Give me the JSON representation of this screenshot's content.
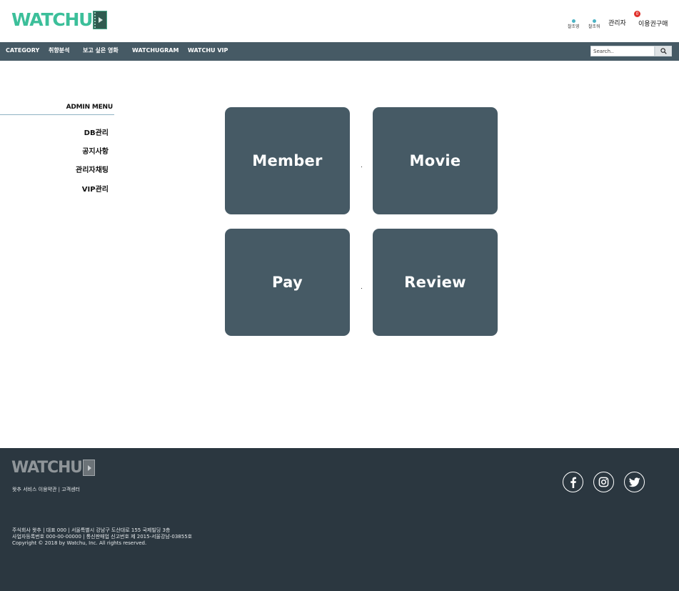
{
  "header": {
    "logo_text": "WATCHU",
    "util_1_label": "찰조영",
    "util_2_label": "찰조워",
    "admin_label": "관리자",
    "cart_count": "0",
    "buy_label": "이용권구매"
  },
  "nav": {
    "items": [
      {
        "label": "CATEGORY"
      },
      {
        "label": "취향분석"
      },
      {
        "label": "보고 싶은 영화"
      },
      {
        "label": "WATCHUGRAM"
      },
      {
        "label": "WATCHU VIP"
      }
    ],
    "search_placeholder": "Search.."
  },
  "sidebar": {
    "title": "ADMIN MENU",
    "items": [
      {
        "label": "DB관리"
      },
      {
        "label": "공지사항"
      },
      {
        "label": "관리자채팅"
      },
      {
        "label": "VIP관리"
      }
    ]
  },
  "tiles": [
    {
      "label": "Member"
    },
    {
      "label": "Movie"
    },
    {
      "label": "Pay"
    },
    {
      "label": "Review"
    }
  ],
  "footer": {
    "logo_text": "WATCHU",
    "link_1": "왓추 서비스 이용약관",
    "link_separator": " | ",
    "link_2": "고객센터",
    "info_line_1": "주식회사 왓추 | 대표 000 | 서울특별시 강남구 도산대로 155 국제빌딩 3층",
    "info_line_2": "사업자등록번호 000-00-00000 | 통신판매업 신고번호 제 2015-서울강남-03855호",
    "copyright": "Copyright © 2018 by Watchu, Inc. All rights reserved."
  },
  "icons": {
    "search": "search-icon",
    "facebook": "facebook-icon",
    "instagram": "instagram-icon",
    "twitter": "twitter-icon"
  },
  "colors": {
    "brand_green": "#3cbf9a",
    "nav_bg": "#465a65",
    "tile_bg": "#465a65",
    "footer_bg": "#2b3740",
    "badge_red": "#e0302a"
  }
}
